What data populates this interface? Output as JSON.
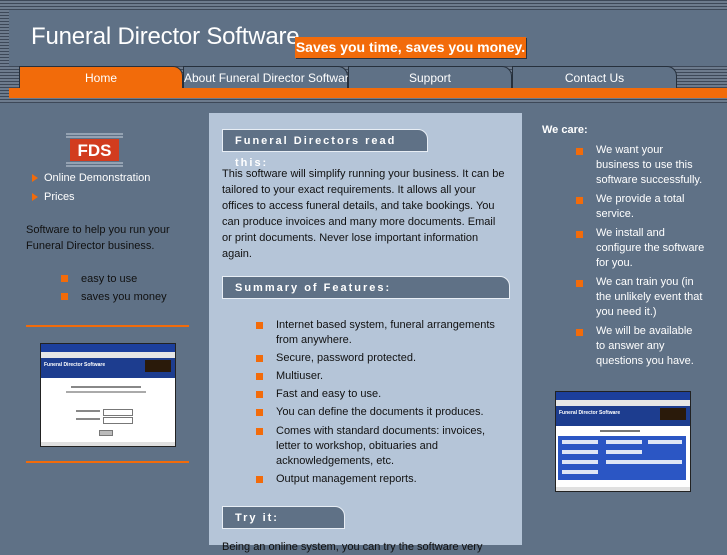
{
  "site": {
    "title": "Funeral Director Software",
    "tagline": "Saves you time, saves you money."
  },
  "nav": {
    "tabs": [
      {
        "label": "Home",
        "active": true
      },
      {
        "label": "About Funeral Director Software",
        "active": false
      },
      {
        "label": "Support",
        "active": false
      },
      {
        "label": "Contact Us",
        "active": false
      }
    ]
  },
  "colors": {
    "accent": "#f26b0a",
    "panel": "#5f7186",
    "center_panel": "#b5c5d8"
  },
  "left": {
    "logo_text": "FDS",
    "links": [
      "Online Demonstration",
      "Prices"
    ],
    "intro": "Software to help you run your Funeral Director business.",
    "bullets": [
      "easy to use",
      "saves you money"
    ],
    "screenshot_title": "Funeral Director Software"
  },
  "center": {
    "sections": [
      {
        "heading": "Funeral Directors read this:"
      },
      {
        "heading": "Summary of Features:"
      },
      {
        "heading": "Try it:"
      }
    ],
    "intro_lines": [
      "This software will simplify running your business. It can be",
      "tailored to your exact requirements. It allows all your",
      "offices to access funeral details, and take bookings. You",
      "can produce invoices and many more documents. Email",
      "or print documents. Never lose important information",
      "again."
    ],
    "features": [
      [
        "Internet based system, funeral arrangements",
        "from anywhere."
      ],
      [
        "Secure, password protected."
      ],
      [
        "Multiuser."
      ],
      [
        "Fast and easy to use."
      ],
      [
        "You can define the documents it produces."
      ],
      [
        "Comes with standard documents: invoices,",
        "letter to workshop, obituaries and",
        "acknowledgements, etc."
      ],
      [
        "Output management reports."
      ]
    ],
    "try_text": "Being an online system, you can try the software very"
  },
  "right": {
    "heading": "We care:",
    "items": [
      [
        "We want your",
        "business to use this",
        "software successfully."
      ],
      [
        "We provide a total",
        "service."
      ],
      [
        "We install and",
        "configure the software",
        "for you."
      ],
      [
        "We can train you (in",
        "the unlikely event that",
        "you need it.)"
      ],
      [
        "We will be available",
        "to answer any",
        "questions you have."
      ]
    ],
    "screenshot_title": "Funeral Director Software"
  }
}
